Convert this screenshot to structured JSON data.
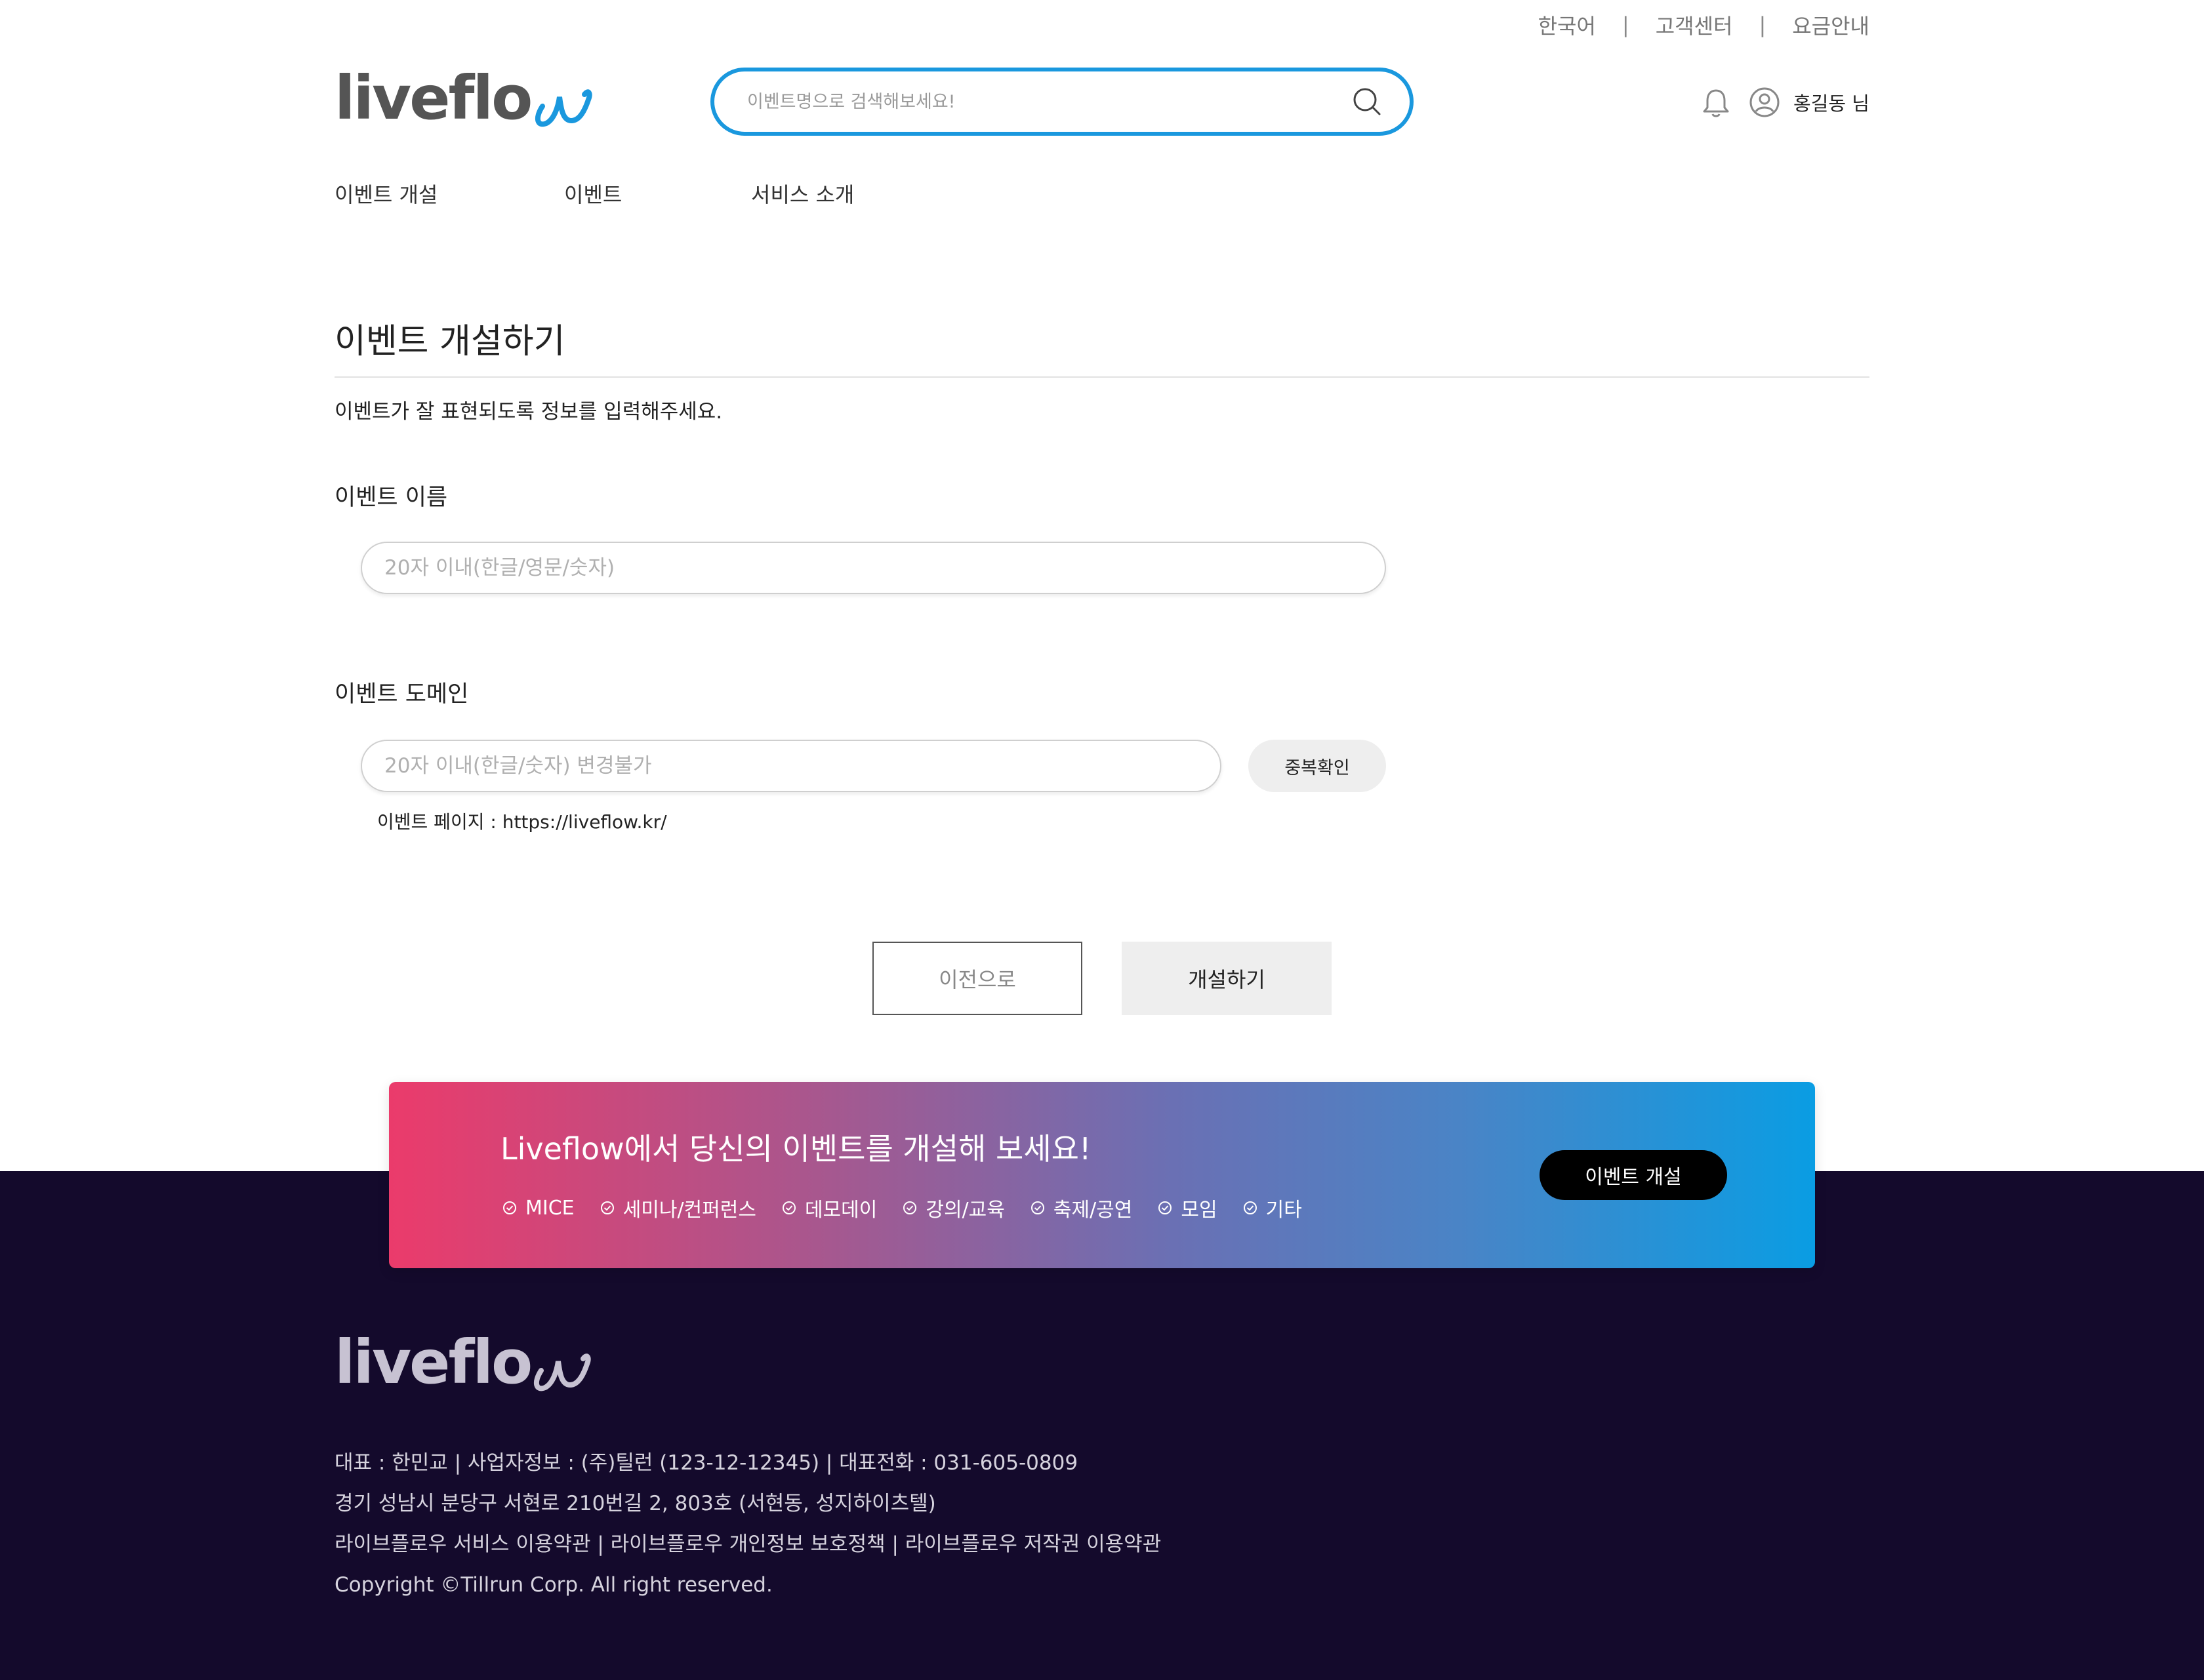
{
  "util_nav": {
    "lang": "한국어",
    "support": "고객센터",
    "pricing": "요금안내",
    "separator": "|"
  },
  "header": {
    "logo_text": "liveflow",
    "search_placeholder": "이벤트명으로 검색해보세요!",
    "user_name": "홍길동 님",
    "icons": {
      "search": "search-icon",
      "notification": "bell-icon",
      "user": "user-circle-icon"
    }
  },
  "nav": {
    "items": [
      "이벤트 개설",
      "이벤트",
      "서비스 소개"
    ]
  },
  "form": {
    "title": "이벤트 개설하기",
    "description": "이벤트가 잘 표현되도록 정보를 입력해주세요.",
    "name_label": "이벤트 이름",
    "name_placeholder": "20자 이내(한글/영문/숫자)",
    "domain_label": "이벤트 도메인",
    "domain_placeholder": "20자 이내(한글/숫자) 변경불가",
    "dup_check_label": "중복확인",
    "page_url": "이벤트 페이지 : https://liveflow.kr/",
    "prev_button": "이전으로",
    "create_button": "개설하기"
  },
  "promo": {
    "title": "Liveflow에서 당신의 이벤트를 개설해 보세요!",
    "tags": [
      "MICE",
      "세미나/컨퍼런스",
      "데모데이",
      "강의/교육",
      "축제/공연",
      "모임",
      "기타"
    ],
    "button": "이벤트 개설",
    "colors": {
      "start": "#eb3b6b",
      "end": "#0a9de3"
    }
  },
  "footer": {
    "logo_text": "liveflow",
    "lines": [
      "대표 : 한민교 | 사업자정보 : (주)틸런 (123-12-12345) | 대표전화 : 031-605-0809",
      "경기 성남시 분당구 서현로 210번길 2, 803호 (서현동, 성지하이츠텔)",
      "라이브플로우 서비스 이용약관 | 라이브플로우 개인정보 보호정책 | 라이브플로우 저작권 이용약관",
      "Copyright ©Tillrun Corp. All right reserved."
    ],
    "background": "#140a2c"
  },
  "colors": {
    "accent": "#1a98de",
    "logo_dot": "#e53a6b"
  }
}
